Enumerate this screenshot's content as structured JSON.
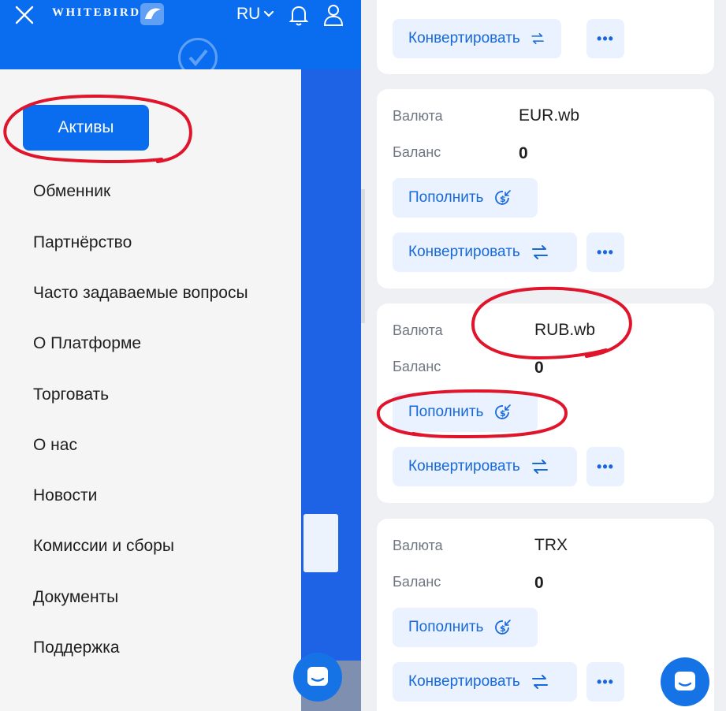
{
  "header": {
    "brand": "WHITEBIRD",
    "language": "RU"
  },
  "sidebar": {
    "active_item": "Активы",
    "items": [
      "Обменник",
      "Партнёрство",
      "Часто задаваемые вопросы",
      "О Платформе",
      "Торговать",
      "О нас",
      "Новости",
      "Комиссии и сборы",
      "Документы",
      "Поддержка"
    ]
  },
  "labels": {
    "currency": "Валюта",
    "balance": "Баланс",
    "deposit": "Пополнить",
    "convert": "Конвертировать",
    "more": "•••"
  },
  "assets": [
    {
      "currency": "EUR.wb",
      "balance": "0"
    },
    {
      "currency": "RUB.wb",
      "balance": "0"
    },
    {
      "currency": "TRX",
      "balance": "0"
    }
  ],
  "colors": {
    "brand_blue": "#0a6df0",
    "annotation_red": "#e0142b",
    "button_bg": "#e9f2fe"
  }
}
